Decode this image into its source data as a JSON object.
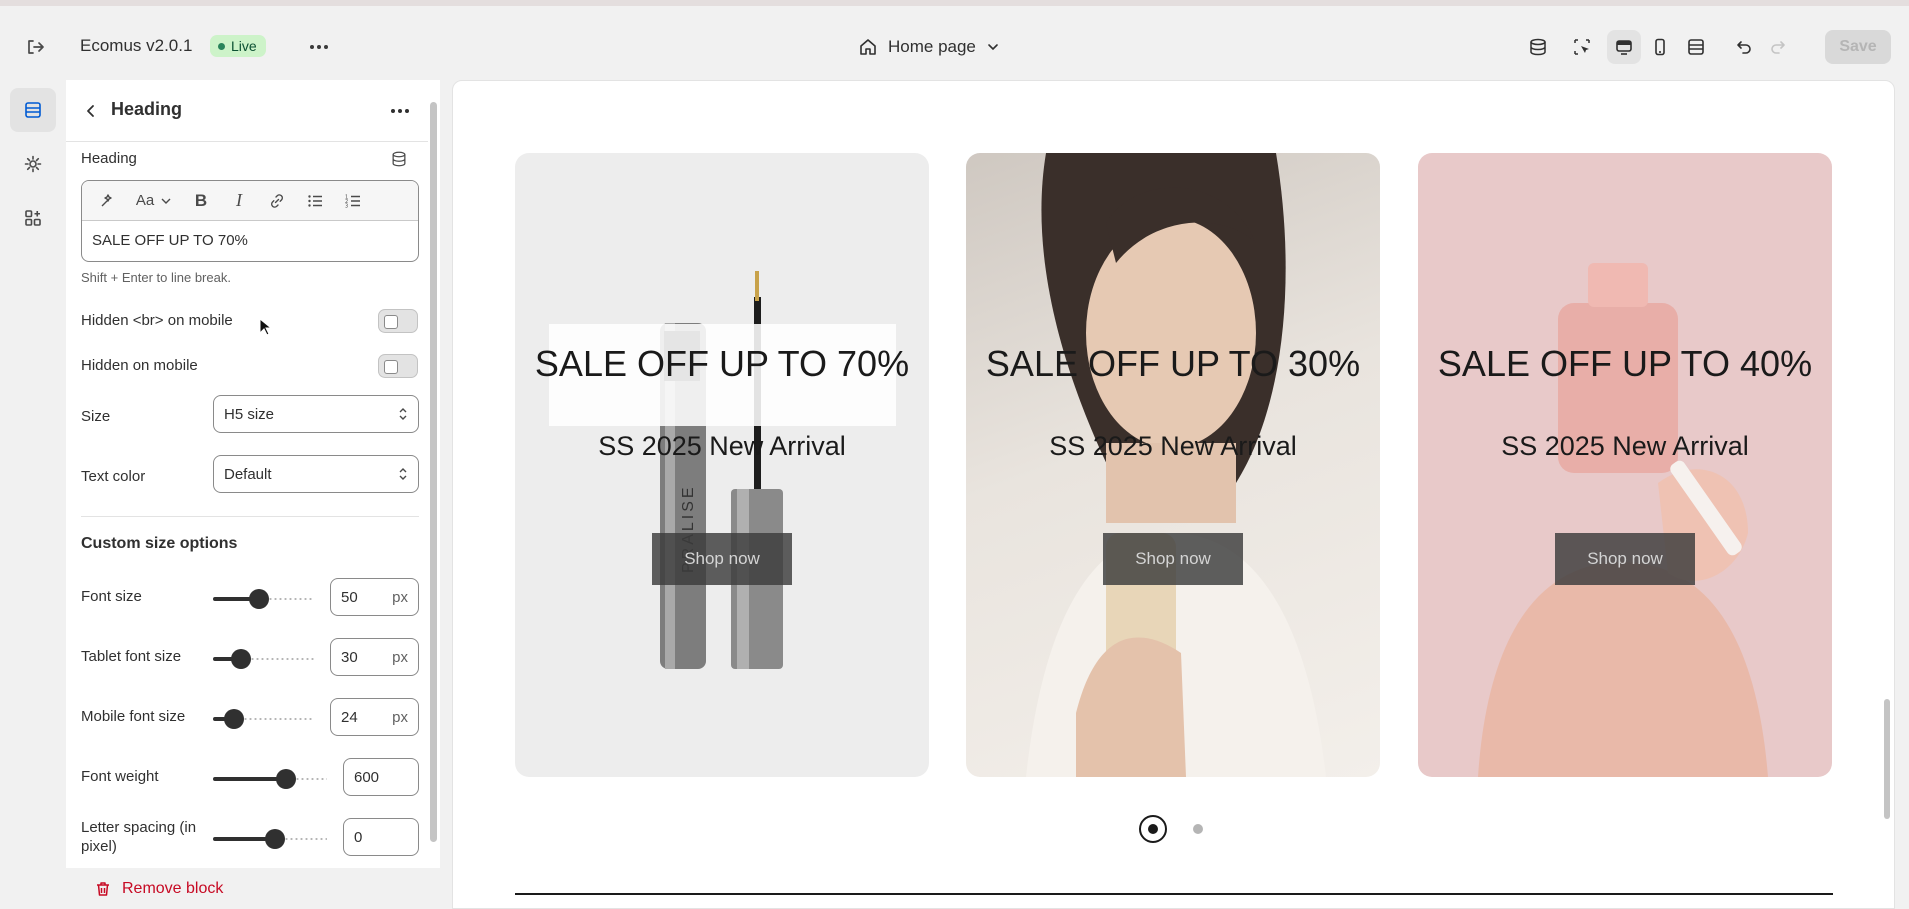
{
  "app": {
    "title": "Ecomus v2.0.1",
    "status": "Live",
    "page_selector": "Home page",
    "save_label": "Save",
    "icons": [
      "exit-icon",
      "more-icon",
      "home-icon",
      "chevron-down-icon",
      "database-icon",
      "inspector-icon",
      "desktop-icon",
      "mobile-icon",
      "fullwidth-icon",
      "undo-icon",
      "redo-icon"
    ]
  },
  "rail": {
    "items": [
      "sections-icon",
      "settings-icon",
      "apps-icon"
    ]
  },
  "panel": {
    "title": "Heading",
    "heading_field": {
      "label": "Heading",
      "value": "SALE OFF UP TO 70%",
      "hint": "Shift + Enter to line break."
    },
    "toggles": [
      {
        "label": "Hidden <br> on mobile",
        "on": false
      },
      {
        "label": "Hidden on mobile",
        "on": false
      }
    ],
    "size": {
      "label": "Size",
      "value": "H5 size"
    },
    "text_color": {
      "label": "Text color",
      "value": "Default"
    },
    "custom_section": "Custom size options",
    "sliders": [
      {
        "label": "Font size",
        "value": "50",
        "unit": "px",
        "fraction": 0.45
      },
      {
        "label": "Tablet font size",
        "value": "30",
        "unit": "px",
        "fraction": 0.25
      },
      {
        "label": "Mobile font size",
        "value": "24",
        "unit": "px",
        "fraction": 0.2
      },
      {
        "label": "Font weight",
        "value": "600",
        "unit": "",
        "fraction": 0.6
      },
      {
        "label": "Letter spacing (in pixel)",
        "value": "0",
        "unit": "",
        "fraction": 0.5
      }
    ],
    "remove_label": "Remove block"
  },
  "preview": {
    "cards": [
      {
        "heading": "SALE OFF UP TO 70%",
        "subtitle": "SS 2025 New Arrival",
        "button": "Shop now",
        "bg": "#ededed",
        "selected": true
      },
      {
        "heading": "SALE OFF UP TO 30%",
        "subtitle": "SS 2025 New Arrival",
        "button": "Shop now",
        "bg": "#dcd6d0",
        "selected": false
      },
      {
        "heading": "SALE OFF UP TO 40%",
        "subtitle": "SS 2025 New Arrival",
        "button": "Shop now",
        "bg": "#e8c9c9",
        "selected": false
      }
    ],
    "product_text": "PRALISE",
    "slides": 2,
    "active_slide": 1
  }
}
